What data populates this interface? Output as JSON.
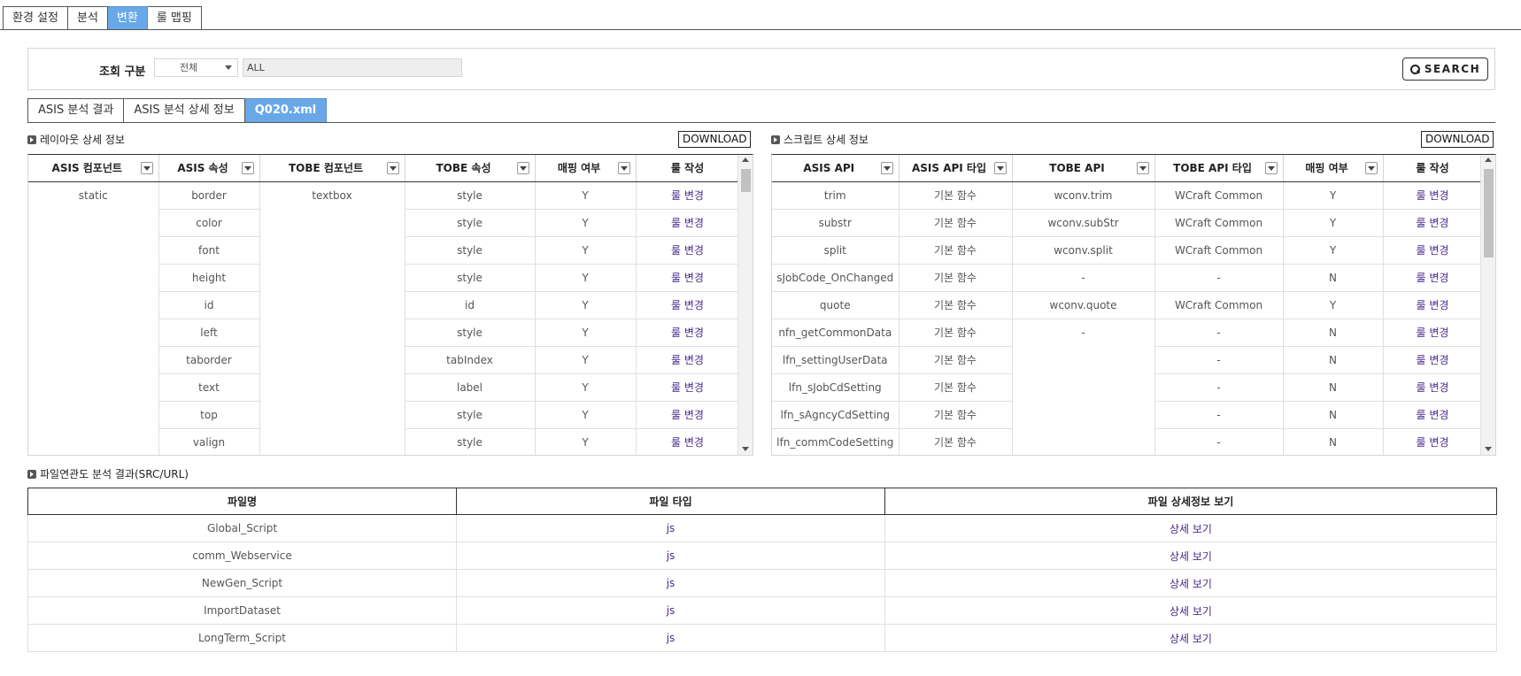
{
  "top_tabs": [
    "환경 설정",
    "분석",
    "변환",
    "룰 맵핑"
  ],
  "search": {
    "label": "조회 구분",
    "select_value": "전체",
    "input_value": "ALL",
    "button_label": "SEARCH"
  },
  "sub_tabs": [
    "ASIS 분석 결과",
    "ASIS 분석 상세 정보",
    "Q020.xml"
  ],
  "layout_section": {
    "title": "레이아웃 상세 정보",
    "download": "DOWNLOAD",
    "columns": [
      "ASIS 컴포넌트",
      "ASIS 속성",
      "TOBE 컴포넌트",
      "TOBE 속성",
      "매핑 여부",
      "룰 작성"
    ],
    "asis_component": "static",
    "tobe_component": "textbox",
    "rows": [
      {
        "asis_attr": "border",
        "tobe_attr": "style",
        "mapped": "Y",
        "rule": "룰 변경"
      },
      {
        "asis_attr": "color",
        "tobe_attr": "style",
        "mapped": "Y",
        "rule": "룰 변경"
      },
      {
        "asis_attr": "font",
        "tobe_attr": "style",
        "mapped": "Y",
        "rule": "룰 변경"
      },
      {
        "asis_attr": "height",
        "tobe_attr": "style",
        "mapped": "Y",
        "rule": "룰 변경"
      },
      {
        "asis_attr": "id",
        "tobe_attr": "id",
        "mapped": "Y",
        "rule": "룰 변경"
      },
      {
        "asis_attr": "left",
        "tobe_attr": "style",
        "mapped": "Y",
        "rule": "룰 변경"
      },
      {
        "asis_attr": "taborder",
        "tobe_attr": "tabIndex",
        "mapped": "Y",
        "rule": "룰 변경"
      },
      {
        "asis_attr": "text",
        "tobe_attr": "label",
        "mapped": "Y",
        "rule": "룰 변경"
      },
      {
        "asis_attr": "top",
        "tobe_attr": "style",
        "mapped": "Y",
        "rule": "룰 변경"
      },
      {
        "asis_attr": "valign",
        "tobe_attr": "style",
        "mapped": "Y",
        "rule": "룰 변경"
      }
    ]
  },
  "script_section": {
    "title": "스크립트 상세 정보",
    "download": "DOWNLOAD",
    "columns": [
      "ASIS API",
      "ASIS API 타입",
      "TOBE API",
      "TOBE API 타입",
      "매핑 여부",
      "룰 작성"
    ],
    "tobe_api_merged": "-",
    "rows": [
      {
        "asis_api": "trim",
        "asis_type": "기본 함수",
        "tobe_api": "wconv.trim",
        "tobe_type": "WCraft Common",
        "mapped": "Y",
        "rule": "룰 변경"
      },
      {
        "asis_api": "substr",
        "asis_type": "기본 함수",
        "tobe_api": "wconv.subStr",
        "tobe_type": "WCraft Common",
        "mapped": "Y",
        "rule": "룰 변경"
      },
      {
        "asis_api": "split",
        "asis_type": "기본 함수",
        "tobe_api": "wconv.split",
        "tobe_type": "WCraft Common",
        "mapped": "Y",
        "rule": "룰 변경"
      },
      {
        "asis_api": "sJobCode_OnChanged",
        "asis_type": "기본 함수",
        "tobe_api": "-",
        "tobe_type": "-",
        "mapped": "N",
        "rule": "룰 변경"
      },
      {
        "asis_api": "quote",
        "asis_type": "기본 함수",
        "tobe_api": "wconv.quote",
        "tobe_type": "WCraft Common",
        "mapped": "Y",
        "rule": "룰 변경"
      },
      {
        "asis_api": "nfn_getCommonData",
        "asis_type": "기본 함수",
        "tobe_api": "",
        "tobe_type": "-",
        "mapped": "N",
        "rule": "룰 변경"
      },
      {
        "asis_api": "lfn_settingUserData",
        "asis_type": "기본 함수",
        "tobe_api": "",
        "tobe_type": "-",
        "mapped": "N",
        "rule": "룰 변경"
      },
      {
        "asis_api": "lfn_sJobCdSetting",
        "asis_type": "기본 함수",
        "tobe_api": "",
        "tobe_type": "-",
        "mapped": "N",
        "rule": "룰 변경"
      },
      {
        "asis_api": "lfn_sAgncyCdSetting",
        "asis_type": "기본 함수",
        "tobe_api": "",
        "tobe_type": "-",
        "mapped": "N",
        "rule": "룰 변경"
      },
      {
        "asis_api": "lfn_commCodeSetting",
        "asis_type": "기본 함수",
        "tobe_api": "",
        "tobe_type": "-",
        "mapped": "N",
        "rule": "룰 변경"
      }
    ]
  },
  "file_section": {
    "title": "파일연관도 분석 결과(SRC/URL)",
    "columns": [
      "파일명",
      "파일 타입",
      "파일 상세정보 보기"
    ],
    "rows": [
      {
        "name": "Global_Script",
        "type": "js",
        "detail": "상세 보기"
      },
      {
        "name": "comm_Webservice",
        "type": "js",
        "detail": "상세 보기"
      },
      {
        "name": "NewGen_Script",
        "type": "js",
        "detail": "상세 보기"
      },
      {
        "name": "ImportDataset",
        "type": "js",
        "detail": "상세 보기"
      },
      {
        "name": "LongTerm_Script",
        "type": "js",
        "detail": "상세 보기"
      }
    ]
  }
}
